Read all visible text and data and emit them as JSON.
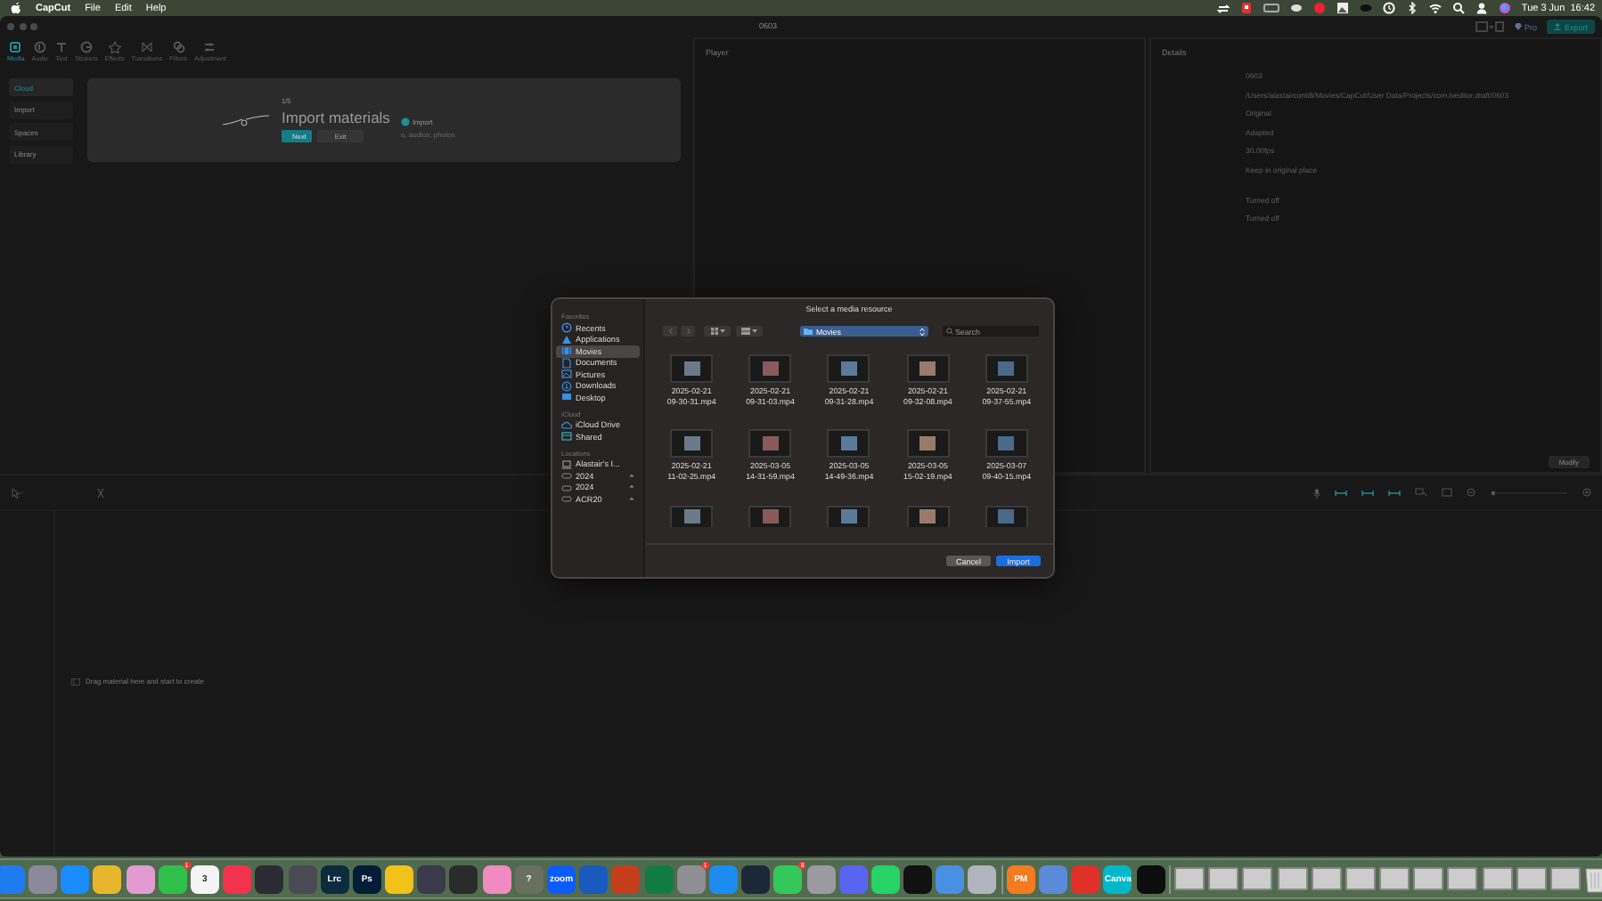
{
  "menu_bar": {
    "app_name": "CapCut",
    "menus": [
      "File",
      "Edit",
      "Help"
    ],
    "clock": "Tue 3 Jun  16:42"
  },
  "window": {
    "title": "0603",
    "pro_label": "Pro",
    "export_button": "Export",
    "toolbar_tabs": [
      {
        "label": "Media",
        "selected": true
      },
      {
        "label": "Audio",
        "selected": false
      },
      {
        "label": "Text",
        "selected": false
      },
      {
        "label": "Stickers",
        "selected": false
      },
      {
        "label": "Effects",
        "selected": false
      },
      {
        "label": "Transitions",
        "selected": false
      },
      {
        "label": "Filters",
        "selected": false
      },
      {
        "label": "Adjustment",
        "selected": false
      }
    ]
  },
  "media_sidebar": [
    {
      "label": "Cloud",
      "selected": true
    },
    {
      "label": "Import",
      "selected": false
    },
    {
      "label": "Spaces",
      "selected": false
    },
    {
      "label": "Library",
      "selected": false
    }
  ],
  "onboarding": {
    "step": "1/5",
    "title": "Import materials",
    "subtitle": "Import",
    "description": "o, audios, photos",
    "next_button": "Next",
    "exit_button": "Exit"
  },
  "player": {
    "title": "Player"
  },
  "details": {
    "title": "Details",
    "values": [
      "0603",
      "/Users/alastairconti8/Movies/CapCut/User Data/Projects/com.lveditor.draft/0603",
      "Original",
      "Adapted",
      "30.00fps",
      "Keep in original place",
      "Turned off",
      "Turned off"
    ],
    "modify_button": "Modify"
  },
  "timeline": {
    "hint": "Drag material here and start to create"
  },
  "dialog": {
    "title": "Select a media resource",
    "location": "Movies",
    "search": {
      "placeholder": "Search"
    },
    "sidebar": [
      {
        "heading": "Favorites",
        "items": [
          {
            "label": "Recents",
            "selected": false
          },
          {
            "label": "Applications",
            "selected": false
          },
          {
            "label": "Movies",
            "selected": true
          },
          {
            "label": "Documents",
            "selected": false
          },
          {
            "label": "Pictures",
            "selected": false
          },
          {
            "label": "Downloads",
            "selected": false
          },
          {
            "label": "Desktop",
            "selected": false
          }
        ]
      },
      {
        "heading": "iCloud",
        "items": [
          {
            "label": "iCloud Drive",
            "selected": false
          },
          {
            "label": "Shared",
            "selected": false
          }
        ]
      },
      {
        "heading": "Locations",
        "items": [
          {
            "label": "Alastair's I...",
            "selected": false
          },
          {
            "label": "2024",
            "selected": false
          },
          {
            "label": "2024",
            "selected": false
          },
          {
            "label": "ACR20",
            "selected": false
          }
        ]
      }
    ],
    "files": [
      {
        "name": "2025-02-21 09-30-31.mp4"
      },
      {
        "name": "2025-02-21 09-31-03.mp4"
      },
      {
        "name": "2025-02-21 09-31-28.mp4"
      },
      {
        "name": "2025-02-21 09-32-08.mp4"
      },
      {
        "name": "2025-02-21 09-37-55.mp4"
      },
      {
        "name": "2025-02-21 11-02-25.mp4"
      },
      {
        "name": "2025-03-05 14-31-59.mp4"
      },
      {
        "name": "2025-03-05 14-49-36.mp4"
      },
      {
        "name": "2025-03-05 15-02-19.mp4"
      },
      {
        "name": "2025-03-07 09-40-15.mp4"
      },
      {
        "cut_off": true
      },
      {
        "cut_off": true
      },
      {
        "cut_off": true
      },
      {
        "cut_off": true
      },
      {
        "cut_off": true
      }
    ],
    "cancel_button": "Cancel",
    "import_button": "Import"
  },
  "dock": [
    {
      "kind": "app",
      "color": "#1e7cf0"
    },
    {
      "kind": "app",
      "color": "#8a8a9a"
    },
    {
      "kind": "app",
      "color": "#1a8cff"
    },
    {
      "kind": "app",
      "color": "#e8b62c"
    },
    {
      "kind": "app",
      "color": "#e29bd0"
    },
    {
      "kind": "app",
      "color": "#2fbf4a",
      "badge": "1"
    },
    {
      "kind": "app",
      "color": "#f4f4f4",
      "label": "3"
    },
    {
      "kind": "app",
      "color": "#f3334d"
    },
    {
      "kind": "app",
      "color": "#2b2b33"
    },
    {
      "kind": "app",
      "color": "#4a4a52"
    },
    {
      "kind": "app",
      "color": "#0d2a3f",
      "label": "Lrc"
    },
    {
      "kind": "app",
      "color": "#001e36",
      "label": "Ps"
    },
    {
      "kind": "app",
      "color": "#f2c21b"
    },
    {
      "kind": "app",
      "color": "#3a3a4a"
    },
    {
      "kind": "app",
      "color": "#2a2a2a"
    },
    {
      "kind": "app",
      "color": "#f08ac0"
    },
    {
      "kind": "app",
      "color": "#6a7060",
      "label": "?"
    },
    {
      "kind": "app",
      "color": "#0b5cff",
      "label": "zoom"
    },
    {
      "kind": "app",
      "color": "#185abd"
    },
    {
      "kind": "app",
      "color": "#c43e1c"
    },
    {
      "kind": "app",
      "color": "#107c41"
    },
    {
      "kind": "app",
      "color": "#8e8e93",
      "badge": "1"
    },
    {
      "kind": "app",
      "color": "#1c8cf0"
    },
    {
      "kind": "app",
      "color": "#1b2838"
    },
    {
      "kind": "app",
      "color": "#34c759",
      "badge": "8"
    },
    {
      "kind": "app",
      "color": "#9a9aa0"
    },
    {
      "kind": "app",
      "color": "#5865f2"
    },
    {
      "kind": "app",
      "color": "#25d366"
    },
    {
      "kind": "app",
      "color": "#111111"
    },
    {
      "kind": "app",
      "color": "#4a90e2"
    },
    {
      "kind": "app",
      "color": "#b0b4bc"
    },
    {
      "kind": "separator"
    },
    {
      "kind": "app",
      "color": "#f47b20",
      "label": "PM"
    },
    {
      "kind": "app",
      "color": "#5a8ad8"
    },
    {
      "kind": "app",
      "color": "#e0302a"
    },
    {
      "kind": "app",
      "color": "#00b8c8",
      "label": "Canva"
    },
    {
      "kind": "app",
      "color": "#0d0d0d"
    },
    {
      "kind": "separator"
    },
    {
      "kind": "window"
    },
    {
      "kind": "window"
    },
    {
      "kind": "window"
    },
    {
      "kind": "window"
    },
    {
      "kind": "window"
    },
    {
      "kind": "window"
    },
    {
      "kind": "window"
    },
    {
      "kind": "window"
    },
    {
      "kind": "window"
    },
    {
      "kind": "window"
    },
    {
      "kind": "window"
    },
    {
      "kind": "window"
    },
    {
      "kind": "trash"
    }
  ]
}
